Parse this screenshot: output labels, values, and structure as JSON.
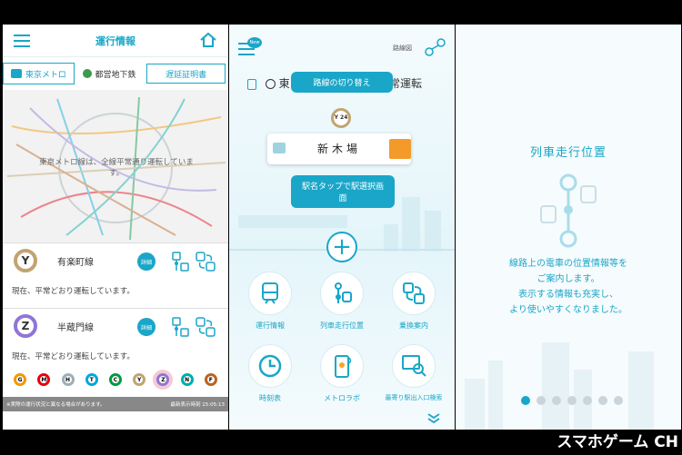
{
  "panel1": {
    "title": "運行情報",
    "tabs": [
      "東京メトロ",
      "都営地下鉄",
      "遅延証明書"
    ],
    "map_message": "東京メトロ線は、全線平常通り運転しています。",
    "lines": [
      {
        "code": "Y",
        "name": "有楽町線",
        "status": "現在、平常どおり運転しています。",
        "color": "#c1a470",
        "detail": "詳細"
      },
      {
        "code": "Z",
        "name": "半蔵門線",
        "status": "現在、平常どおり運転しています。",
        "color": "#8f76d6",
        "detail": "詳細"
      }
    ],
    "line_chips": [
      {
        "code": "G",
        "color": "#f39700"
      },
      {
        "code": "M",
        "color": "#e60012"
      },
      {
        "code": "H",
        "color": "#9caeb7"
      },
      {
        "code": "T",
        "color": "#00a7db"
      },
      {
        "code": "C",
        "color": "#009944"
      },
      {
        "code": "Y",
        "color": "#c1a470"
      },
      {
        "code": "Z",
        "color": "#8f76d6"
      },
      {
        "code": "N",
        "color": "#00ada9"
      },
      {
        "code": "F",
        "color": "#bb641d"
      }
    ],
    "footer_left": "※実際の運行状況と異なる場合があります。",
    "footer_right": "最新表示時刻 15:05:13"
  },
  "panel2": {
    "new_badge": "New",
    "route_map": "路線図",
    "header_left": "東",
    "header_right": "常運転",
    "tooltip_top": "路線の切り替え",
    "line_badge": "Y 24",
    "station": "新木場",
    "tooltip_bottom": "駅名タップで駅選択画面",
    "menu": [
      {
        "label": "運行情報",
        "icon": "train-icon"
      },
      {
        "label": "列車走行位置",
        "icon": "train-position-icon"
      },
      {
        "label": "乗換案内",
        "icon": "transfer-icon"
      },
      {
        "label": "時刻表",
        "icon": "clock-icon"
      },
      {
        "label": "メトロラボ",
        "icon": "smartphone-icon"
      },
      {
        "label": "最寄り駅出入口検索",
        "icon": "exit-icon"
      }
    ]
  },
  "panel3": {
    "title": "列車走行位置",
    "desc1": "線路上の電車の位置情報等を",
    "desc2": "ご案内します。",
    "desc3": "表示する情報も充実し、",
    "desc4": "より使いやすくなりました。",
    "dots_total": 7,
    "dots_active": 1
  },
  "watermark": "スマホゲーム CH",
  "accent": "#1aa6c8"
}
